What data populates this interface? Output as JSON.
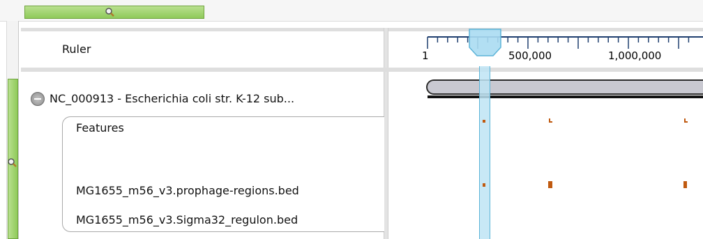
{
  "ruler": {
    "label": "Ruler",
    "ticks": [
      "1",
      "500,000",
      "1,000,000"
    ]
  },
  "sequence": {
    "label": "NC_000913 - Escherichia coli str. K-12 sub..."
  },
  "features": {
    "group_label": "Features",
    "tracks": [
      {
        "label": "MG1655_m56_v3.prophage-regions.bed"
      },
      {
        "label": "MG1655_m56_v3.Sigma32_regulon.bed"
      }
    ]
  },
  "icons": {
    "h_scroll": "zoom-icon",
    "v_scroll": "zoom-icon",
    "collapse": "collapse-minus-icon"
  },
  "colors": {
    "scroll_green": "#8fca5a",
    "viewport_blue": "#bfe4f5",
    "feature_orange": "#c05a10",
    "chromosome_fill": "#c9c9d1"
  }
}
